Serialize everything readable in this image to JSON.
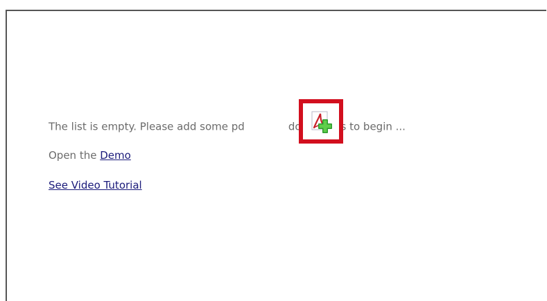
{
  "empty_state": {
    "message_before": "The list is empty. Please add some pd",
    "message_after": "documents to begin ...",
    "add_icon": "add-pdf-icon"
  },
  "demo": {
    "prefix": "Open the ",
    "link_label": "Demo"
  },
  "video": {
    "link_label": "See Video Tutorial"
  },
  "colors": {
    "highlight": "#d20f1e",
    "link": "#1a1a7a",
    "text": "#6b6b6b"
  }
}
